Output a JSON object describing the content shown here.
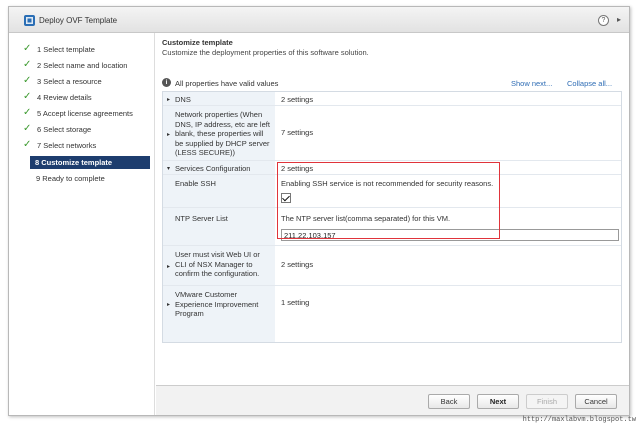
{
  "window": {
    "title": "Deploy OVF Template",
    "help_icon": "?",
    "expand_icon": "▸"
  },
  "sidebar": {
    "steps": [
      {
        "label": "1  Select template",
        "done": true
      },
      {
        "label": "2  Select name and location",
        "done": true
      },
      {
        "label": "3  Select a resource",
        "done": true
      },
      {
        "label": "4  Review details",
        "done": true
      },
      {
        "label": "5  Accept license agreements",
        "done": true
      },
      {
        "label": "6  Select storage",
        "done": true
      },
      {
        "label": "7  Select networks",
        "done": true
      },
      {
        "label": "8  Customize template",
        "done": false,
        "active": true
      },
      {
        "label": "9  Ready to complete",
        "done": false
      }
    ]
  },
  "main": {
    "heading": "Customize template",
    "subheading": "Customize the deployment properties of this software solution.",
    "status": "All properties have valid values",
    "show_next": "Show next...",
    "collapse_all": "Collapse all...",
    "rows": {
      "dns": {
        "label": "DNS",
        "value": "2 settings"
      },
      "network": {
        "label": "Network properties (When DNS, IP address, etc are left blank, these properties will be supplied by DHCP server (LESS SECURE))",
        "value": "7 settings"
      },
      "services": {
        "label": "Services Configuration",
        "value": "2 settings"
      },
      "ssh": {
        "label": "Enable SSH",
        "description": "Enabling SSH service is not recommended for security reasons.",
        "checked": true
      },
      "ntp": {
        "label": "NTP Server List",
        "description": "The NTP server list(comma separated) for this VM.",
        "value": "211.22.103.157"
      },
      "webui": {
        "label": "User must visit Web UI or CLI of NSX Manager to confirm the configuration.",
        "value": "2 settings"
      },
      "ceip": {
        "label": "VMware Customer Experience Improvement Program",
        "value": "1 setting"
      }
    }
  },
  "footer": {
    "back": "Back",
    "next": "Next",
    "finish": "Finish",
    "cancel": "Cancel"
  },
  "watermark": "http://maxlabvm.blogspot.tw",
  "colors": {
    "active_step": "#1d3d6e",
    "check": "#3c9a2f",
    "link": "#2f6db5",
    "highlight": "#e0343b"
  }
}
